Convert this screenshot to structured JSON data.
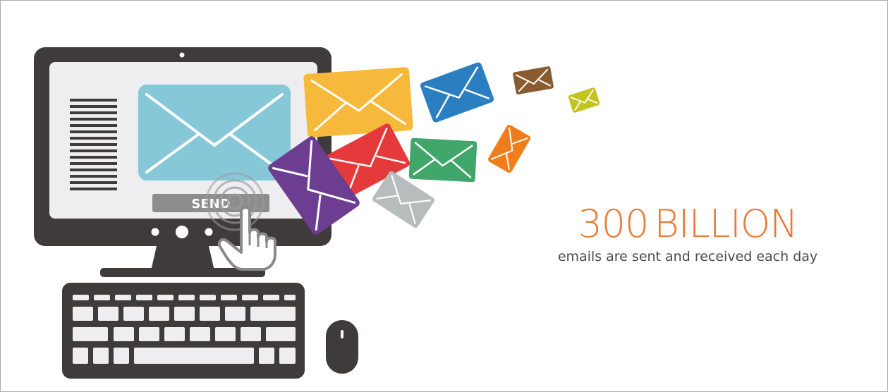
{
  "illustration": {
    "send_button_label": "SEND"
  },
  "stat": {
    "number": "300",
    "unit": "BILLION",
    "caption": "emails are sent and received each day"
  },
  "colors": {
    "accent": "#ea7b36",
    "dark": "#3e3b3a",
    "screen": "#eeeef0",
    "email_blue_light": "#86c8d8"
  },
  "envelopes": [
    {
      "color": "#f6b93b",
      "name": "yellow"
    },
    {
      "color": "#2b7fc1",
      "name": "blue"
    },
    {
      "color": "#8a5a30",
      "name": "brown"
    },
    {
      "color": "#c3c41f",
      "name": "lime"
    },
    {
      "color": "#e43a3c",
      "name": "red"
    },
    {
      "color": "#41a66a",
      "name": "green"
    },
    {
      "color": "#f07d1b",
      "name": "orange"
    },
    {
      "color": "#6c3d91",
      "name": "purple"
    },
    {
      "color": "#b7bcbd",
      "name": "gray"
    }
  ]
}
